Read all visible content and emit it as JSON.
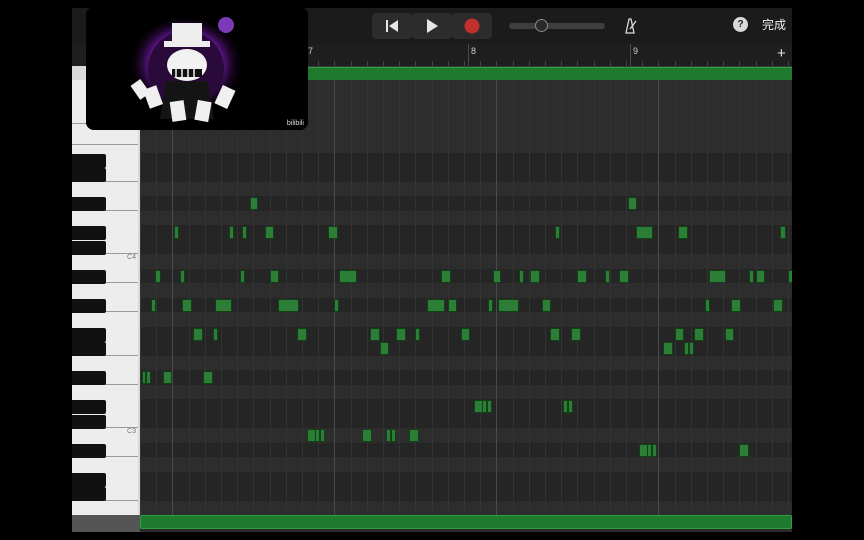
{
  "toolbar": {
    "done_label": "完成",
    "help_label": "?"
  },
  "ruler": {
    "bars": [
      "7",
      "8",
      "9"
    ],
    "add_label": "+"
  },
  "keyboard": {
    "labels": [
      "C4",
      "C3"
    ]
  },
  "thumbnail": {
    "watermark": "bilibili"
  },
  "colors": {
    "note": "#2c7d35",
    "region": "#1f7a2e",
    "record": "#c0302c"
  },
  "notes": [
    {
      "row": 8,
      "start": 6.8,
      "len": 0.5
    },
    {
      "row": 8,
      "start": 30.1,
      "len": 0.6
    },
    {
      "row": 10,
      "start": 2.1,
      "len": 0.3
    },
    {
      "row": 10,
      "start": 5.5,
      "len": 0.3
    },
    {
      "row": 10,
      "start": 6.3,
      "len": 0.3
    },
    {
      "row": 10,
      "start": 7.7,
      "len": 0.6
    },
    {
      "row": 10,
      "start": 11.6,
      "len": 0.6
    },
    {
      "row": 10,
      "start": 25.6,
      "len": 0.3
    },
    {
      "row": 10,
      "start": 30.6,
      "len": 1.1
    },
    {
      "row": 10,
      "start": 33.2,
      "len": 0.6
    },
    {
      "row": 10,
      "start": 39.5,
      "len": 0.4
    },
    {
      "row": 13,
      "start": 0.9,
      "len": 0.4
    },
    {
      "row": 13,
      "start": 2.5,
      "len": 0.3
    },
    {
      "row": 13,
      "start": 6.2,
      "len": 0.3
    },
    {
      "row": 13,
      "start": 8.0,
      "len": 0.6
    },
    {
      "row": 13,
      "start": 12.3,
      "len": 1.1
    },
    {
      "row": 13,
      "start": 18.6,
      "len": 0.6
    },
    {
      "row": 13,
      "start": 21.8,
      "len": 0.5
    },
    {
      "row": 13,
      "start": 23.4,
      "len": 0.3
    },
    {
      "row": 13,
      "start": 24.1,
      "len": 0.6
    },
    {
      "row": 13,
      "start": 27.0,
      "len": 0.6
    },
    {
      "row": 13,
      "start": 28.7,
      "len": 0.3
    },
    {
      "row": 13,
      "start": 29.6,
      "len": 0.6
    },
    {
      "row": 13,
      "start": 35.1,
      "len": 1.1
    },
    {
      "row": 13,
      "start": 37.6,
      "len": 0.3
    },
    {
      "row": 13,
      "start": 38.0,
      "len": 0.6
    },
    {
      "row": 13,
      "start": 40.0,
      "len": 0.6
    },
    {
      "row": 15,
      "start": 0.7,
      "len": 0.3
    },
    {
      "row": 15,
      "start": 2.6,
      "len": 0.6
    },
    {
      "row": 15,
      "start": 4.6,
      "len": 1.1
    },
    {
      "row": 15,
      "start": 8.5,
      "len": 1.3
    },
    {
      "row": 15,
      "start": 12.0,
      "len": 0.3
    },
    {
      "row": 15,
      "start": 17.7,
      "len": 1.1
    },
    {
      "row": 15,
      "start": 19.0,
      "len": 0.6
    },
    {
      "row": 15,
      "start": 21.5,
      "len": 0.3
    },
    {
      "row": 15,
      "start": 22.1,
      "len": 1.3
    },
    {
      "row": 15,
      "start": 24.8,
      "len": 0.6
    },
    {
      "row": 15,
      "start": 34.9,
      "len": 0.3
    },
    {
      "row": 15,
      "start": 36.5,
      "len": 0.6
    },
    {
      "row": 15,
      "start": 39.1,
      "len": 0.6
    },
    {
      "row": 17,
      "start": 3.3,
      "len": 0.6
    },
    {
      "row": 17,
      "start": 4.5,
      "len": 0.3
    },
    {
      "row": 17,
      "start": 9.7,
      "len": 0.6
    },
    {
      "row": 17,
      "start": 14.2,
      "len": 0.6
    },
    {
      "row": 17,
      "start": 15.8,
      "len": 0.6
    },
    {
      "row": 17,
      "start": 17.0,
      "len": 0.3
    },
    {
      "row": 17,
      "start": 19.8,
      "len": 0.6
    },
    {
      "row": 17,
      "start": 25.3,
      "len": 0.6
    },
    {
      "row": 17,
      "start": 26.6,
      "len": 0.6
    },
    {
      "row": 17,
      "start": 33.0,
      "len": 0.6
    },
    {
      "row": 17,
      "start": 34.2,
      "len": 0.6
    },
    {
      "row": 17,
      "start": 36.1,
      "len": 0.6
    },
    {
      "row": 18,
      "start": 14.8,
      "len": 0.6
    },
    {
      "row": 18,
      "start": 32.3,
      "len": 0.6
    },
    {
      "row": 18,
      "start": 33.6,
      "len": 0.3
    },
    {
      "row": 18,
      "start": 33.9,
      "len": 0.3
    },
    {
      "row": 20,
      "start": 0.1,
      "len": 0.3
    },
    {
      "row": 20,
      "start": 0.4,
      "len": 0.3
    },
    {
      "row": 20,
      "start": 1.4,
      "len": 0.6
    },
    {
      "row": 20,
      "start": 3.9,
      "len": 0.6
    },
    {
      "row": 22,
      "start": 20.6,
      "len": 0.6
    },
    {
      "row": 22,
      "start": 21.1,
      "len": 0.3
    },
    {
      "row": 22,
      "start": 21.4,
      "len": 0.3
    },
    {
      "row": 22,
      "start": 26.1,
      "len": 0.3
    },
    {
      "row": 22,
      "start": 26.4,
      "len": 0.3
    },
    {
      "row": 24,
      "start": 10.3,
      "len": 0.6
    },
    {
      "row": 24,
      "start": 10.8,
      "len": 0.3
    },
    {
      "row": 24,
      "start": 11.1,
      "len": 0.3
    },
    {
      "row": 24,
      "start": 13.7,
      "len": 0.6
    },
    {
      "row": 24,
      "start": 15.2,
      "len": 0.3
    },
    {
      "row": 24,
      "start": 15.5,
      "len": 0.3
    },
    {
      "row": 24,
      "start": 16.6,
      "len": 0.6
    },
    {
      "row": 25,
      "start": 30.8,
      "len": 0.6
    },
    {
      "row": 25,
      "start": 31.3,
      "len": 0.3
    },
    {
      "row": 25,
      "start": 31.6,
      "len": 0.3
    },
    {
      "row": 25,
      "start": 37.0,
      "len": 0.6
    }
  ]
}
